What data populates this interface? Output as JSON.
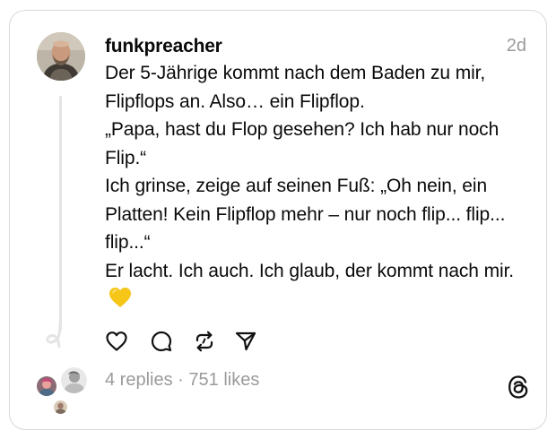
{
  "post": {
    "username": "funkpreacher",
    "timestamp": "2d",
    "lines": [
      "Der 5-Jährige kommt nach dem Baden zu mir, Flipflops an. Also… ein Flipflop.",
      "„Papa, hast du Flop gesehen? Ich hab nur noch Flip.“",
      "Ich grinse, zeige auf seinen Fuß: „Oh nein, ein Platten! Kein Flipflop mehr – nur noch flip... flip... flip...“",
      "Er lacht. Ich auch. Ich glaub, der kommt nach mir."
    ],
    "emoji": "💛"
  },
  "actions": [
    "heart-icon",
    "comment-icon",
    "repost-icon",
    "share-icon"
  ],
  "stats": {
    "replies": "4 replies",
    "separator": " · ",
    "likes": "751 likes"
  },
  "colors": {
    "text": "#0a0a0a",
    "muted": "#9a9a9a",
    "border": "#d9d9d9",
    "heart_emoji": "#f5c518"
  }
}
